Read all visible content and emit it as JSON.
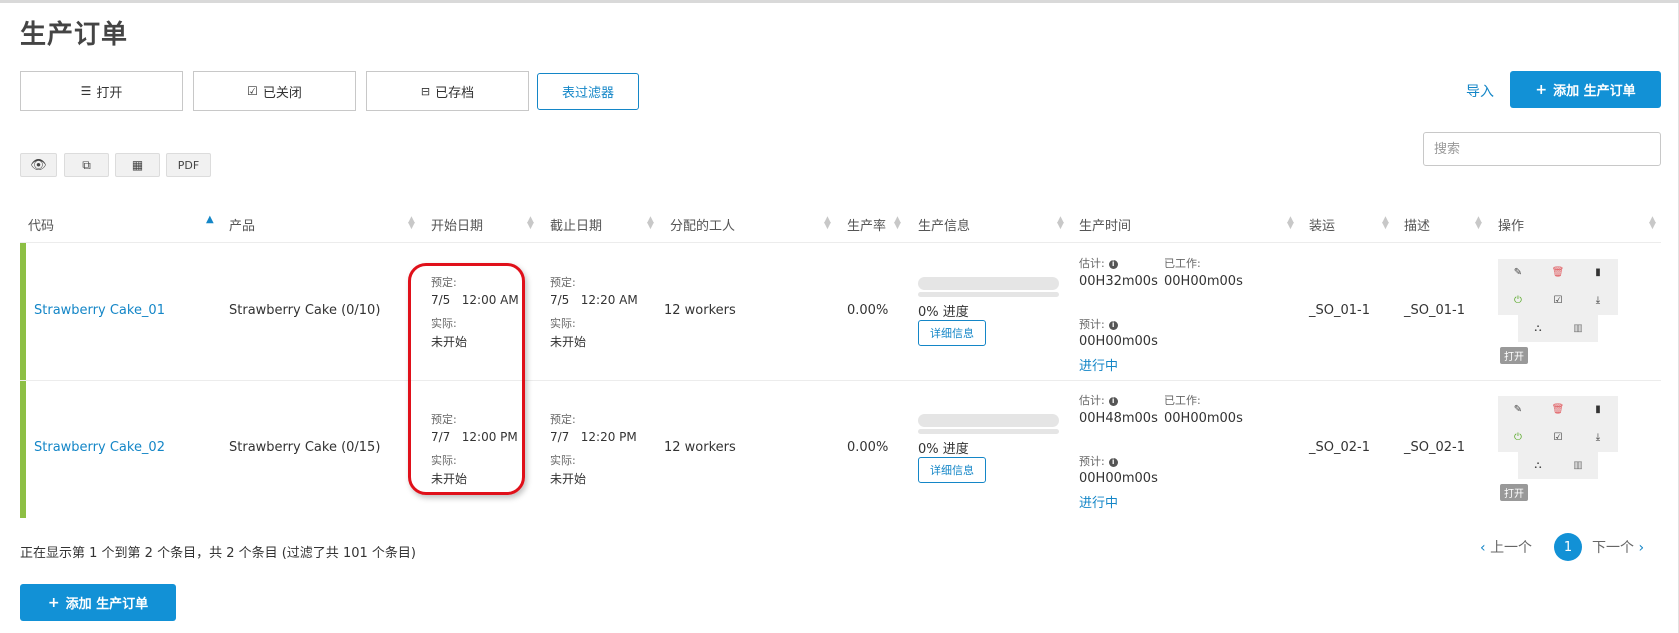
{
  "page": {
    "title": "生产订单"
  },
  "tabs": {
    "open": "打开",
    "closed": "已关闭",
    "archived": "已存档",
    "filter": "表过滤器"
  },
  "header": {
    "import": "导入",
    "add": "添加 生产订单"
  },
  "toolbar": {
    "pdf": "PDF"
  },
  "search": {
    "placeholder": "搜索"
  },
  "columns": {
    "code": "代码",
    "product": "产品",
    "start": "开始日期",
    "end": "截止日期",
    "workers": "分配的工人",
    "rate": "生产率",
    "info": "生产信息",
    "time": "生产时间",
    "ship": "装运",
    "desc": "描述",
    "ops": "操作"
  },
  "labels": {
    "planned": "预定:",
    "actual": "实际:",
    "progress_suffix": "进度",
    "details": "详细信息",
    "estimated": "估计:",
    "worked": "已工作:",
    "forecast": "预计:",
    "open_badge": "打开"
  },
  "rows": [
    {
      "code": "Strawberry Cake_01",
      "product": "Strawberry Cake (0/10)",
      "start_plan_date": "7/5",
      "start_plan_time": "12:00 AM",
      "start_actual": "未开始",
      "end_plan_date": "7/5",
      "end_plan_time": "12:20 AM",
      "end_actual": "未开始",
      "workers": "12 workers",
      "rate": "0.00%",
      "progress": "0%",
      "estimated": "00H32m00s",
      "worked": "00H00m00s",
      "forecast": "00H00m00s",
      "status": "进行中",
      "ship": "_SO_01-1",
      "desc": "_SO_01-1"
    },
    {
      "code": "Strawberry Cake_02",
      "product": "Strawberry Cake (0/15)",
      "start_plan_date": "7/7",
      "start_plan_time": "12:00 PM",
      "start_actual": "未开始",
      "end_plan_date": "7/7",
      "end_plan_time": "12:20 PM",
      "end_actual": "未开始",
      "workers": "12 workers",
      "rate": "0.00%",
      "progress": "0%",
      "estimated": "00H48m00s",
      "worked": "00H00m00s",
      "forecast": "00H00m00s",
      "status": "进行中",
      "ship": "_SO_02-1",
      "desc": "_SO_02-1"
    }
  ],
  "footer": {
    "summary": "正在显示第 1 个到第 2 个条目，共 2 个条目 (过滤了共 101 个条目)"
  },
  "pagination": {
    "prev": "上一个",
    "page": "1",
    "next": "下一个"
  },
  "colors": {
    "accent": "#1291d6",
    "row_bar": "#8dbf44",
    "highlight": "#e0101a"
  }
}
